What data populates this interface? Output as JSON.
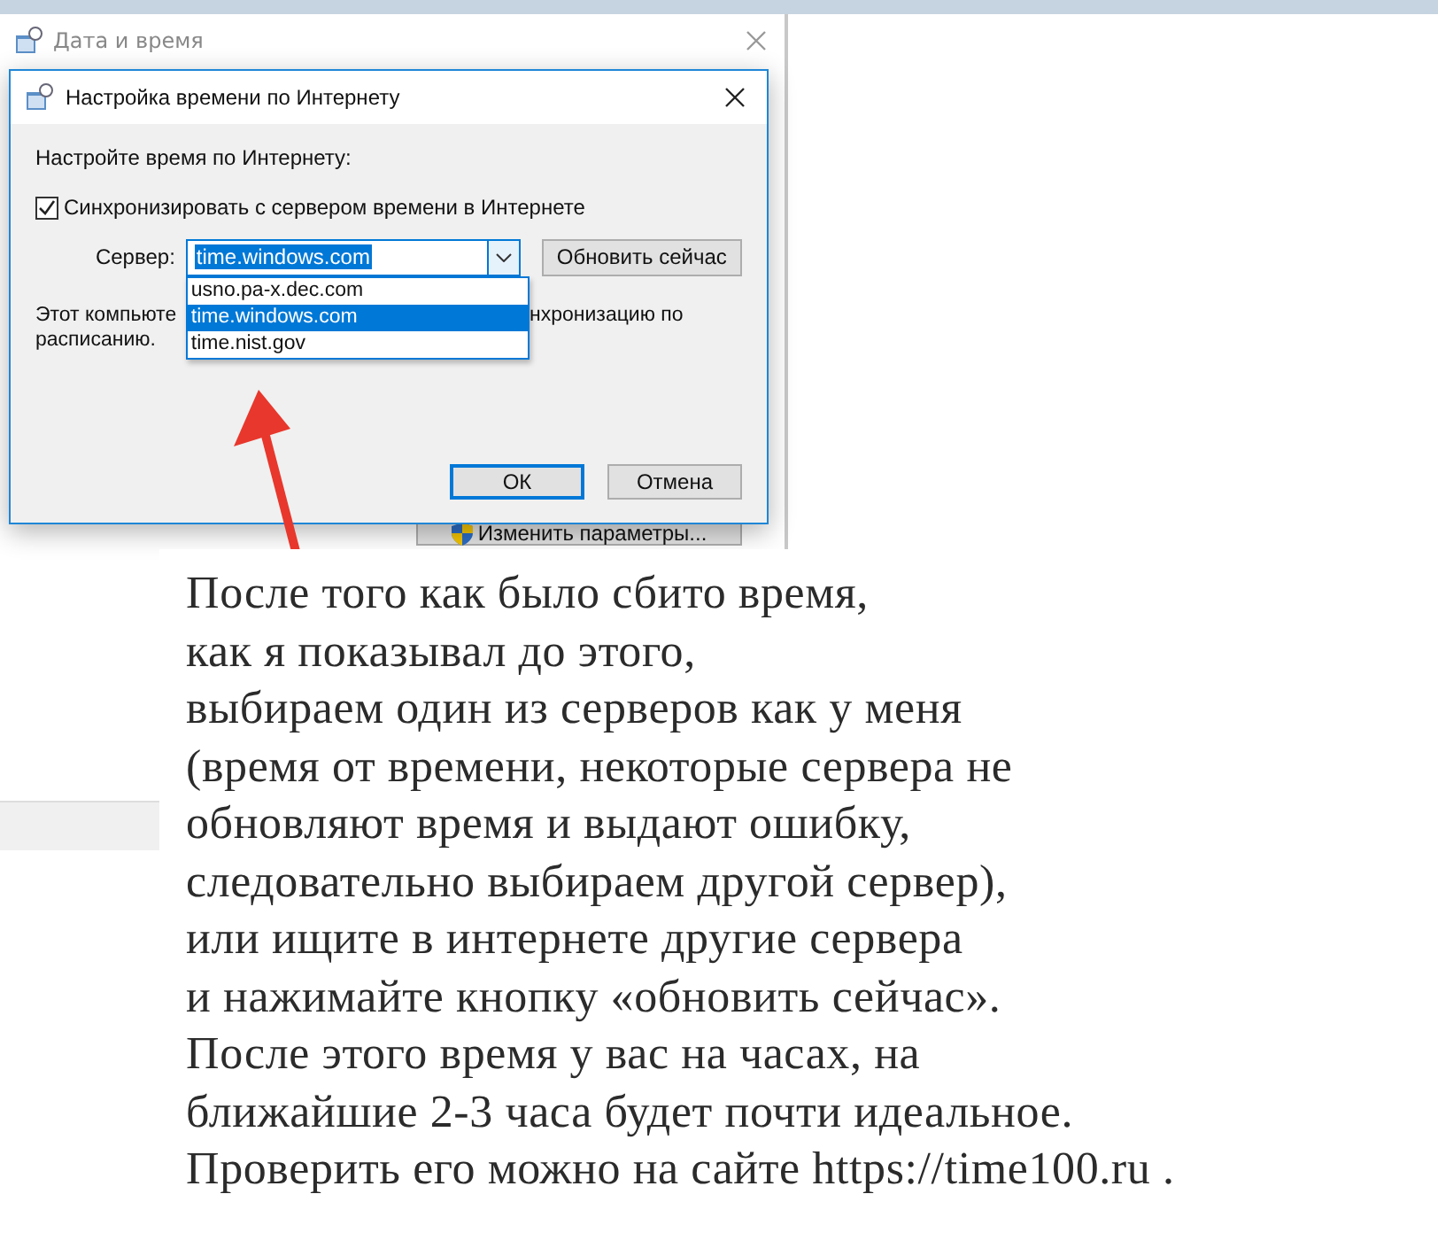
{
  "background_window": {
    "title": "Дата и время",
    "change_button": "Изменить параметры..."
  },
  "dialog": {
    "title": "Настройка времени по Интернету",
    "heading": "Настройте время по Интернету:",
    "sync": {
      "label": "Синхронизировать с сервером времени в Интернете",
      "checked": true
    },
    "server_label": "Сервер:",
    "server_value": "time.windows.com",
    "update_button": "Обновить сейчас",
    "dropdown": [
      {
        "label": "usno.pa-x.dec.com",
        "selected": false
      },
      {
        "label": "time.windows.com",
        "selected": true
      },
      {
        "label": "time.nist.gov",
        "selected": false
      }
    ],
    "info_left": [
      "Этот компьюте",
      "расписанию."
    ],
    "info_right": "нхронизацию по",
    "buttons": [
      {
        "label": "ОК",
        "default": true
      },
      {
        "label": "Отмена",
        "default": false
      }
    ]
  },
  "annotation": {
    "lines": [
      "После того как было сбито время,",
      "как я показывал до этого,",
      "выбираем один из серверов как у меня",
      "(время от времени, некоторые сервера не",
      "обновляют время и выдают ошибку,",
      "следовательно выбираем другой сервер),",
      "или ищите в интернете другие сервера",
      "и нажимайте кнопку «обновить сейчас».",
      "После этого время у вас на часах, на",
      "ближайшие 2-3 часа будет почти идеальное.",
      "Проверить его можно на сайте https://time100.ru ."
    ]
  }
}
